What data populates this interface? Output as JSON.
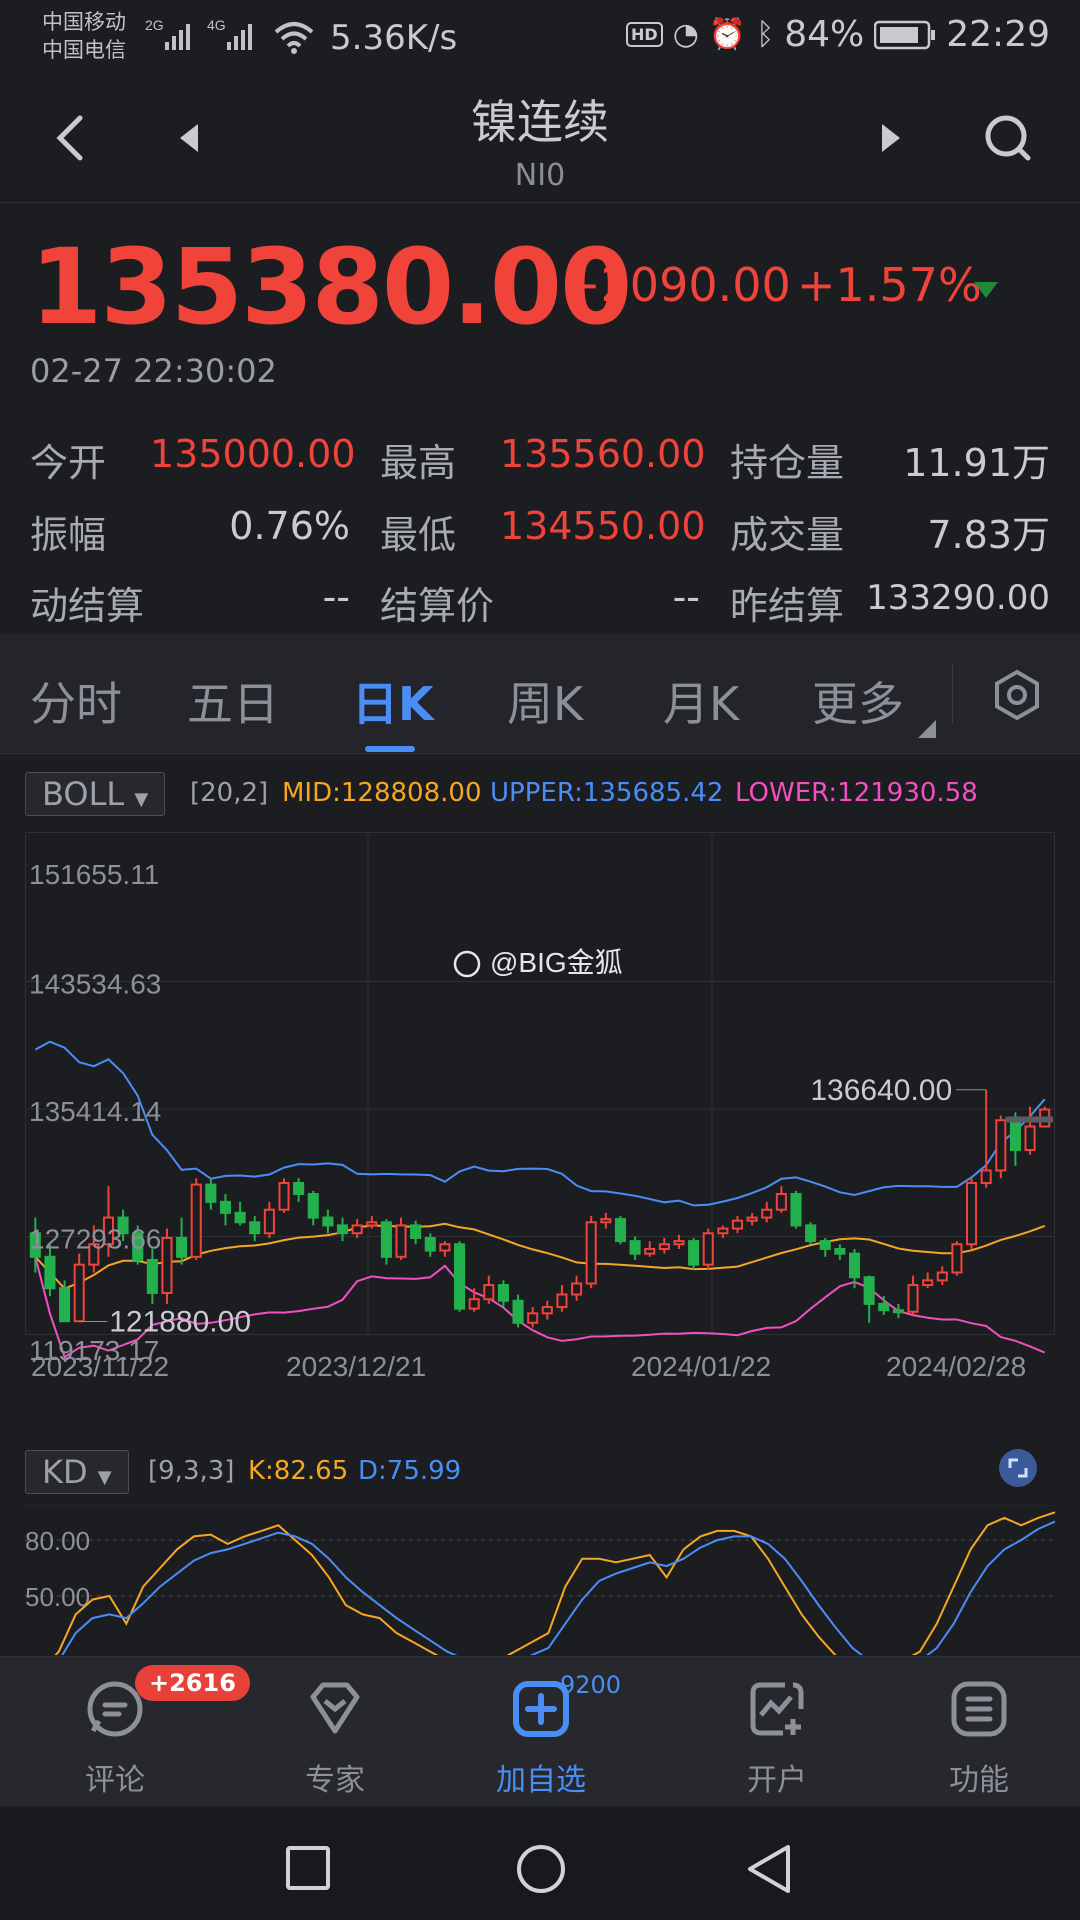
{
  "status_bar": {
    "carrier1": "中国移动",
    "carrier2": "中国电信",
    "net1": "2G",
    "net2": "4G",
    "speed": "5.36K/s",
    "hd": "HD",
    "battery": "84%",
    "time": "22:29"
  },
  "header": {
    "title": "镍连续",
    "code": "NI0"
  },
  "quote": {
    "price": "135380.00",
    "change": "+2090.00",
    "change_pct": "+1.57%",
    "timestamp": "02-27 22:30:02"
  },
  "stats": [
    {
      "label": "今开",
      "value": "135000.00",
      "color": "red"
    },
    {
      "label": "最高",
      "value": "135560.00",
      "color": "red"
    },
    {
      "label": "持仓量",
      "value": "11.91万",
      "color": "neutral"
    },
    {
      "label": "振幅",
      "value": "0.76%",
      "color": "neutral"
    },
    {
      "label": "最低",
      "value": "134550.00",
      "color": "red"
    },
    {
      "label": "成交量",
      "value": "7.83万",
      "color": "neutral"
    },
    {
      "label": "动结算",
      "value": "--",
      "color": "neutral"
    },
    {
      "label": "结算价",
      "value": "--",
      "color": "neutral"
    },
    {
      "label": "昨结算",
      "value": "133290.00",
      "color": "neutral"
    }
  ],
  "tabs": [
    "分时",
    "五日",
    "日K",
    "周K",
    "月K",
    "更多"
  ],
  "active_tab": "日K",
  "indicator": {
    "name": "BOLL",
    "params": "[20,2]",
    "mid": "MID:128808.00",
    "upper": "UPPER:135685.42",
    "lower": "LOWER:121930.58"
  },
  "chart_labels": {
    "y_ticks": [
      "151655.11",
      "143534.63",
      "135414.14",
      "127293.66",
      "119173.17"
    ],
    "x_ticks": [
      "2023/11/22",
      "2023/12/21",
      "2024/01/22",
      "2024/02/28"
    ],
    "high_marker": "136640.00",
    "low_marker": "121880.00",
    "watermark": "@BIG金狐"
  },
  "kd": {
    "name": "KD",
    "params": "[9,3,3]",
    "k": "K:82.65",
    "d": "D:75.99",
    "y_ticks": [
      "80.00",
      "50.00"
    ]
  },
  "bottom_nav": [
    {
      "label": "评论",
      "icon": "comment-icon",
      "badge": "+2616"
    },
    {
      "label": "专家",
      "icon": "expert-icon"
    },
    {
      "label": "加自选",
      "icon": "add-watchlist-icon",
      "badge": "9200"
    },
    {
      "label": "开户",
      "icon": "open-account-icon"
    },
    {
      "label": "功能",
      "icon": "function-icon"
    }
  ],
  "colors": {
    "up": "#f0433a",
    "down": "#22b14c",
    "mid": "#f5a623",
    "upper": "#4a8ef5",
    "lower": "#f050c0",
    "accent": "#4a8ef5"
  },
  "chart_data": {
    "type": "candlestick",
    "indicator": "BOLL",
    "x_ticks": [
      "2023/11/22",
      "2023/12/21",
      "2024/01/22",
      "2024/02/28"
    ],
    "ylim": [
      119173.17,
      151655.11
    ],
    "candles": [
      [
        127500,
        126000,
        128500,
        125000
      ],
      [
        126000,
        124000,
        126800,
        123500
      ],
      [
        124000,
        121900,
        124500,
        121880
      ],
      [
        121900,
        125500,
        126200,
        121880
      ],
      [
        125500,
        126800,
        128000,
        125000
      ],
      [
        126800,
        128500,
        130500,
        126000
      ],
      [
        128500,
        127500,
        129000,
        127000
      ],
      [
        127500,
        125800,
        128000,
        125500
      ],
      [
        125800,
        123700,
        126500,
        123000
      ],
      [
        123700,
        127200,
        127800,
        123000
      ],
      [
        127200,
        126000,
        128500,
        125500
      ],
      [
        126000,
        130600,
        131000,
        125800
      ],
      [
        130600,
        129500,
        131000,
        129000
      ],
      [
        129500,
        128800,
        130000,
        128000
      ],
      [
        128800,
        128200,
        129500,
        128000
      ],
      [
        128200,
        127500,
        128600,
        127000
      ],
      [
        127500,
        129000,
        129500,
        127200
      ],
      [
        129000,
        130700,
        131000,
        128800
      ],
      [
        130700,
        130000,
        131000,
        129500
      ],
      [
        130000,
        128500,
        130200,
        128000
      ],
      [
        128500,
        128000,
        129000,
        127500
      ],
      [
        128000,
        127500,
        128500,
        127000
      ],
      [
        127500,
        128000,
        128400,
        127200
      ],
      [
        128000,
        128200,
        128600,
        127800
      ],
      [
        128200,
        126000,
        128400,
        125500
      ],
      [
        126000,
        128000,
        128500,
        125800
      ],
      [
        128000,
        127200,
        128300,
        126800
      ],
      [
        127200,
        126400,
        127500,
        126000
      ],
      [
        126400,
        126800,
        127000,
        126000
      ],
      [
        126800,
        122700,
        127000,
        122500
      ],
      [
        122700,
        123300,
        124000,
        122500
      ],
      [
        123300,
        124200,
        124800,
        123000
      ],
      [
        124200,
        123200,
        124500,
        122800
      ],
      [
        123200,
        121800,
        123600,
        121500
      ],
      [
        121800,
        122400,
        122800,
        121500
      ],
      [
        122400,
        122800,
        123200,
        122000
      ],
      [
        122800,
        123600,
        124200,
        122500
      ],
      [
        123600,
        124300,
        124800,
        123200
      ],
      [
        124300,
        128200,
        128600,
        124000
      ],
      [
        128200,
        128400,
        128800,
        127800
      ],
      [
        128400,
        127000,
        128600,
        126800
      ],
      [
        127000,
        126200,
        127300,
        125800
      ],
      [
        126200,
        126500,
        127000,
        126000
      ],
      [
        126500,
        126800,
        127200,
        126200
      ],
      [
        126800,
        127000,
        127400,
        126500
      ],
      [
        127000,
        125500,
        127200,
        125200
      ],
      [
        125500,
        127500,
        127800,
        125200
      ],
      [
        127500,
        127800,
        128000,
        127200
      ],
      [
        127800,
        128300,
        128600,
        127500
      ],
      [
        128300,
        128500,
        128800,
        128000
      ],
      [
        128500,
        129000,
        129500,
        128200
      ],
      [
        129000,
        130000,
        130500,
        128800
      ],
      [
        130000,
        128000,
        130200,
        127800
      ],
      [
        128000,
        127000,
        128200,
        126800
      ],
      [
        127000,
        126500,
        127200,
        126000
      ],
      [
        126500,
        126200,
        126800,
        125800
      ],
      [
        126200,
        124700,
        126500,
        124000
      ],
      [
        124700,
        123000,
        124800,
        121800
      ],
      [
        123000,
        122600,
        123500,
        122300
      ],
      [
        122600,
        122500,
        123000,
        122100
      ],
      [
        122500,
        124200,
        124800,
        122300
      ],
      [
        124200,
        124500,
        125000,
        124000
      ],
      [
        124500,
        125000,
        125400,
        124200
      ],
      [
        125000,
        126800,
        127000,
        124800
      ],
      [
        126800,
        130700,
        131000,
        126500
      ],
      [
        130700,
        131500,
        136640,
        130400
      ],
      [
        131500,
        134700,
        135000,
        131000
      ],
      [
        134700,
        132800,
        135200,
        131800
      ],
      [
        132800,
        134300,
        135560,
        132500
      ],
      [
        134300,
        135380,
        135560,
        134550
      ]
    ]
  }
}
